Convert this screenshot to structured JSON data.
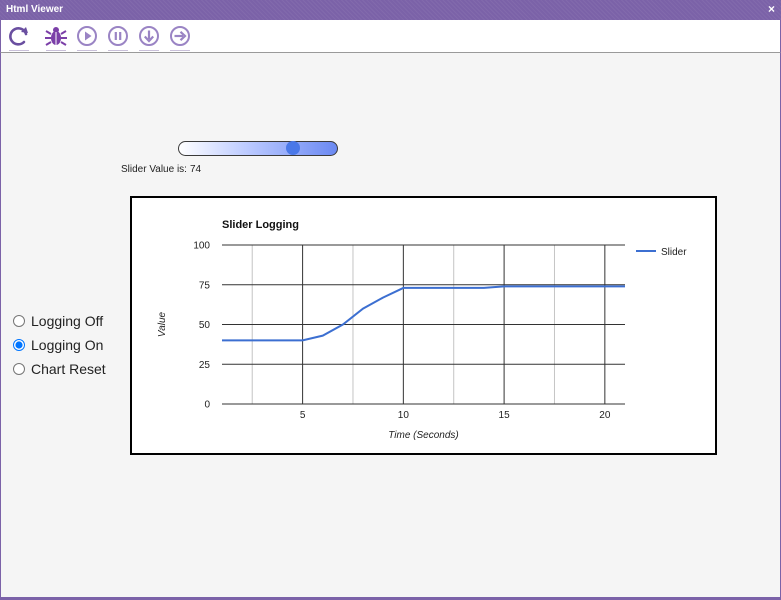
{
  "window": {
    "title": "Html Viewer",
    "close_glyph": "×"
  },
  "toolbar": {
    "buttons": [
      {
        "icon": "refresh-icon"
      },
      {
        "icon": "bug-icon"
      },
      {
        "icon": "play-icon"
      },
      {
        "icon": "pause-icon"
      },
      {
        "icon": "step-into-icon"
      },
      {
        "icon": "step-over-icon"
      }
    ],
    "accent_color": "#7b62a8"
  },
  "slider": {
    "value": 74,
    "min": 0,
    "max": 100,
    "label_prefix": "Slider Value is:",
    "label_value": "74",
    "fill_color": "#6b89f2",
    "thumb_color": "#4a78e8"
  },
  "radio": {
    "options": [
      {
        "label": "Logging Off",
        "checked": false
      },
      {
        "label": "Logging On",
        "checked": true
      },
      {
        "label": "Chart Reset",
        "checked": false
      }
    ]
  },
  "chart_data": {
    "type": "line",
    "title": "Slider Logging",
    "xlabel": "Time (Seconds)",
    "ylabel": "Value",
    "xlim": [
      1,
      21
    ],
    "ylim": [
      0,
      100
    ],
    "x_ticks": [
      5,
      10,
      15,
      20
    ],
    "x_tick_labels": [
      "5",
      "10",
      "15",
      "20"
    ],
    "x_minor_gridlines": [
      2.5,
      7.5,
      12.5,
      17.5
    ],
    "y_ticks": [
      0,
      25,
      50,
      75,
      100
    ],
    "y_tick_labels": [
      "0",
      "25",
      "50",
      "75",
      "100"
    ],
    "grid": true,
    "legend_position": "top-right",
    "series": [
      {
        "name": "Slider",
        "color": "#3c6fd1",
        "x": [
          1,
          2,
          3,
          4,
          5,
          6,
          7,
          8,
          9,
          10,
          11,
          12,
          13,
          14,
          15,
          16,
          17,
          18,
          19,
          20,
          21
        ],
        "y": [
          40,
          40,
          40,
          40,
          40,
          43,
          50,
          60,
          67,
          73,
          73,
          73,
          73,
          73,
          74,
          74,
          74,
          74,
          74,
          74,
          74
        ]
      }
    ]
  }
}
